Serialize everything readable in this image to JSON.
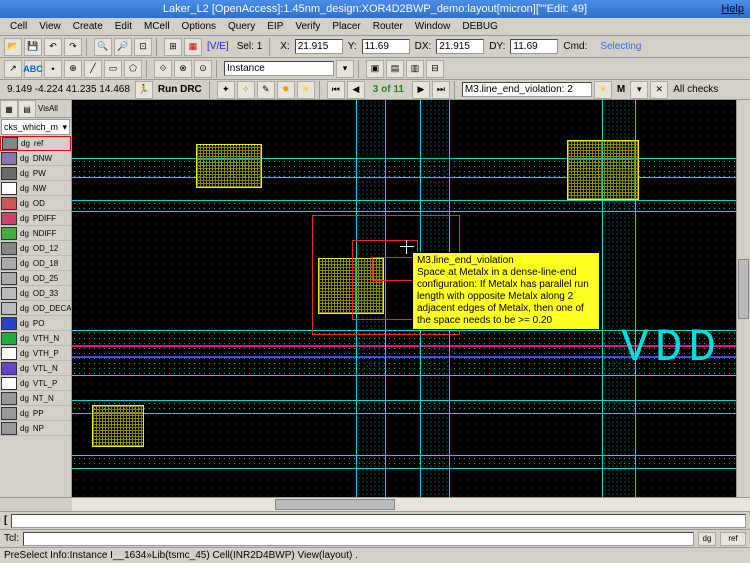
{
  "title": "Laker_L2 [OpenAccess]:1.45nm_design:XOR4D2BWP_demo:layout[micron][\"\"Edit: 49]",
  "help": "Help",
  "menus": [
    "Cell",
    "View",
    "Create",
    "Edit",
    "MCell",
    "Options",
    "Query",
    "EIP",
    "Verify",
    "Placer",
    "Router",
    "Window",
    "DEBUG"
  ],
  "toolbar1": {
    "ve": "[V/E]",
    "sel": "Sel: 1",
    "x_label": "X:",
    "x_val": "21.915",
    "y_label": "Y:",
    "y_val": "11.69",
    "dx_label": "DX:",
    "dx_val": "21.915",
    "dy_label": "DY:",
    "dy_val": "11.69",
    "cmd_label": "Cmd:",
    "cmd_val": "Selecting"
  },
  "toolbar2": {
    "instance": "Instance"
  },
  "toolbar3": {
    "coords": "9.149 -4.224 41.235 14.468",
    "run_drc": "Run DRC",
    "count": "3 of 11",
    "violation": "M3.line_end_violation: 2",
    "m_label": "M",
    "all_checks": "All checks"
  },
  "layer_panel": {
    "vis_all": "VisAll",
    "dropdown": "cks_which_m",
    "col1": "dg",
    "items": [
      {
        "name": "ref",
        "swatch": "#7a888a"
      },
      {
        "name": "DNW",
        "swatch": "#8877aa"
      },
      {
        "name": "PW",
        "swatch": "#6a6a6a"
      },
      {
        "name": "NW",
        "swatch": "#ffffff"
      },
      {
        "name": "OD",
        "swatch": "#cc5555"
      },
      {
        "name": "PDIFF",
        "swatch": "#cc4466"
      },
      {
        "name": "NDIFF",
        "swatch": "#44aa44"
      },
      {
        "name": "OD_12",
        "swatch": "#888888"
      },
      {
        "name": "OD_18",
        "swatch": "#aaaaaa"
      },
      {
        "name": "OD_25",
        "swatch": "#aaaaaa"
      },
      {
        "name": "OD_33",
        "swatch": "#bbbbbb"
      },
      {
        "name": "OD_DECA",
        "swatch": "#bbbbbb"
      },
      {
        "name": "PO",
        "swatch": "#2244cc"
      },
      {
        "name": "VTH_N",
        "swatch": "#22aa44"
      },
      {
        "name": "VTH_P",
        "swatch": "#ffffff"
      },
      {
        "name": "VTL_N",
        "swatch": "#6644cc"
      },
      {
        "name": "VTL_P",
        "swatch": "#ffffff"
      },
      {
        "name": "NT_N",
        "swatch": "#999999"
      },
      {
        "name": "PP",
        "swatch": "#999999"
      },
      {
        "name": "NP",
        "swatch": "#999999"
      }
    ]
  },
  "tooltip": {
    "title": "M3.line_end_violation",
    "body": "Space at Metalx in a dense-line-end configuration: If Metalx has parallel run length with opposite Metalx along 2 adjacent edges of Metalx, then one of the space needs to be >= 0.20"
  },
  "vdd": "VDD",
  "cmd_row": {
    "tcl": "Tcl:",
    "tag1": "dg",
    "tag2": "ref"
  },
  "status": "PreSelect Info:Instance I__1634»Lib(tsmc_45) Cell(INR2D4BWP) View(layout) ."
}
